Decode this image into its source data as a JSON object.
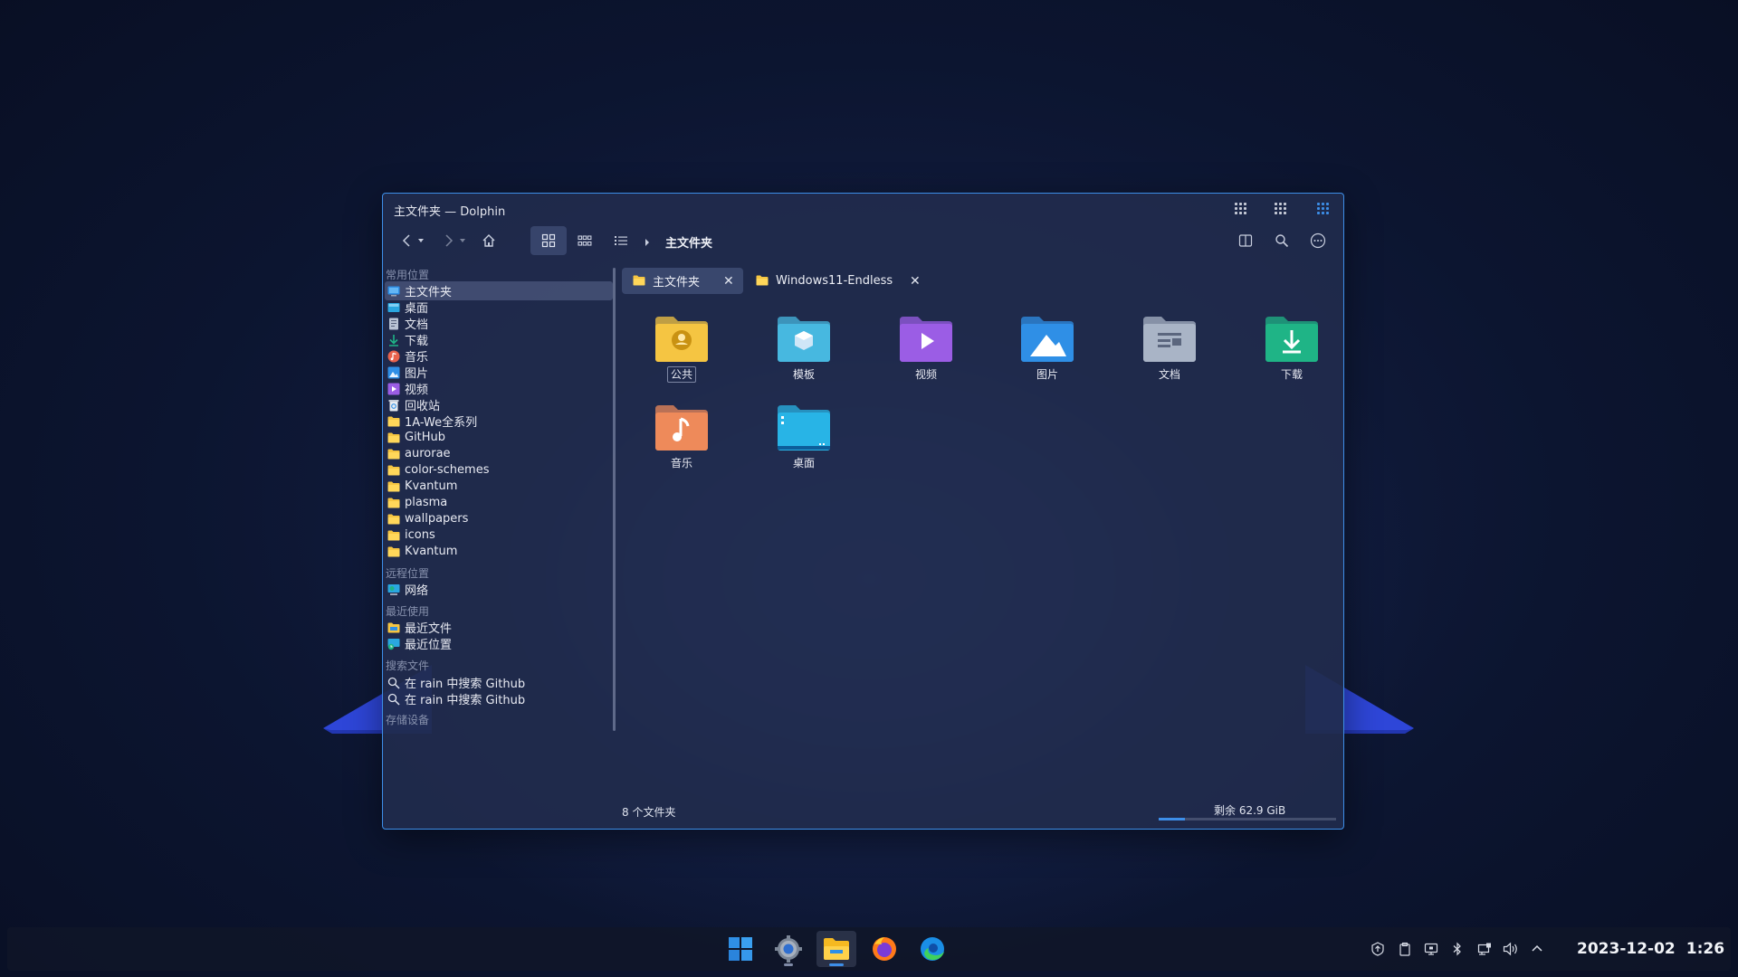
{
  "window": {
    "title": "主文件夹 — Dolphin",
    "breadcrumb": "主文件夹"
  },
  "sidebar": {
    "sections": {
      "places": "常用位置",
      "remote": "远程位置",
      "recent": "最近使用",
      "search": "搜索文件",
      "devices": "存储设备"
    },
    "places": [
      {
        "label": "主文件夹",
        "icon": "home-folder-icon"
      },
      {
        "label": "桌面",
        "icon": "desktop-icon"
      },
      {
        "label": "文档",
        "icon": "document-icon"
      },
      {
        "label": "下载",
        "icon": "download-icon"
      },
      {
        "label": "音乐",
        "icon": "music-icon"
      },
      {
        "label": "图片",
        "icon": "picture-icon"
      },
      {
        "label": "视频",
        "icon": "video-icon"
      },
      {
        "label": "回收站",
        "icon": "trash-icon"
      },
      {
        "label": "1A-We全系列",
        "icon": "folder-icon"
      },
      {
        "label": "GitHub",
        "icon": "folder-icon"
      },
      {
        "label": "aurorae",
        "icon": "folder-icon"
      },
      {
        "label": "color-schemes",
        "icon": "folder-icon"
      },
      {
        "label": "Kvantum",
        "icon": "folder-icon"
      },
      {
        "label": "plasma",
        "icon": "folder-icon"
      },
      {
        "label": "wallpapers",
        "icon": "folder-icon"
      },
      {
        "label": "icons",
        "icon": "folder-icon"
      },
      {
        "label": "Kvantum",
        "icon": "folder-icon"
      }
    ],
    "remote": [
      {
        "label": "网络",
        "icon": "network-icon"
      }
    ],
    "recent": [
      {
        "label": "最近文件",
        "icon": "recent-files-icon"
      },
      {
        "label": "最近位置",
        "icon": "recent-locations-icon"
      }
    ],
    "searches": [
      {
        "label": "在 rain 中搜索 Github",
        "icon": "search-icon"
      },
      {
        "label": "在 rain 中搜索 Github",
        "icon": "search-icon"
      }
    ]
  },
  "tabs": [
    {
      "label": "主文件夹",
      "active": true
    },
    {
      "label": "Windows11-Endless",
      "active": false
    }
  ],
  "files": [
    {
      "name": "公共",
      "color": "#f5c542",
      "icon": "public-folder-icon"
    },
    {
      "name": "模板",
      "color": "#47b8e0",
      "icon": "templates-folder-icon"
    },
    {
      "name": "视频",
      "color": "#9b5de5",
      "icon": "videos-folder-icon"
    },
    {
      "name": "图片",
      "color": "#2f8fe6",
      "icon": "pictures-folder-icon"
    },
    {
      "name": "文档",
      "color": "#a9b4c6",
      "icon": "documents-folder-icon"
    },
    {
      "name": "下载",
      "color": "#1fb486",
      "icon": "downloads-folder-icon"
    },
    {
      "name": "音乐",
      "color": "#ee8a5a",
      "icon": "music-folder-icon"
    },
    {
      "name": "桌面",
      "color": "#28b4e6",
      "icon": "desktop-folder-icon"
    }
  ],
  "status": {
    "count": "8 个文件夹",
    "free_space": "剩余 62.9 GiB",
    "used_fraction": 0.15
  },
  "taskbar": {
    "apps": [
      "start-icon",
      "settings-icon",
      "file-manager-icon",
      "firefox-icon",
      "edge-icon"
    ],
    "date": "2023-12-02",
    "time": "1:26"
  },
  "colors": {
    "accent": "#3d8ee8",
    "folder": "#f5c542"
  }
}
